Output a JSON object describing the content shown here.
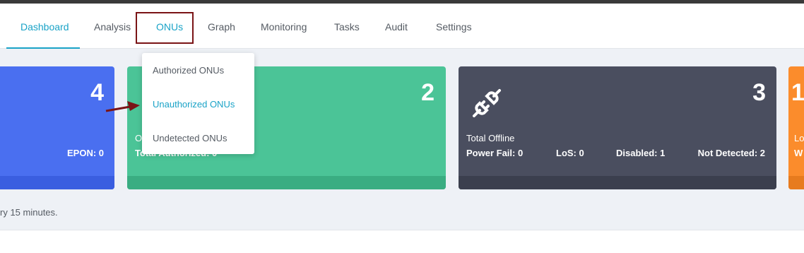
{
  "nav": {
    "items": [
      "Dashboard",
      "Analysis",
      "ONUs",
      "Graph",
      "Monitoring",
      "Tasks",
      "Audit",
      "Settings"
    ],
    "active": "Dashboard",
    "highlighted": "ONUs"
  },
  "onus_dropdown": {
    "items": [
      "Authorized ONUs",
      "Unauthorized ONUs",
      "Undetected ONUs"
    ],
    "active": "Unauthorized ONUs"
  },
  "cards": {
    "blue": {
      "count": "4",
      "stat": "EPON: 0"
    },
    "green": {
      "count": "2",
      "label_fragment": "O",
      "stat_fragment": "Total Authorized: 0"
    },
    "dark": {
      "count": "3",
      "icon": "plug-disconnected-icon",
      "label": "Total Offline",
      "stats": [
        "Power Fail: 0",
        "LoS: 0",
        "Disabled: 1",
        "Not Detected: 2"
      ]
    },
    "orange": {
      "count": "1",
      "label_fragment": "Lo",
      "stat_fragment": "W"
    }
  },
  "footer_note": "ry 15 minutes.",
  "colors": {
    "accent": "#1aa3c7",
    "highlight_box": "#7a1416",
    "card_blue": "#4a6ff0",
    "card_green": "#4bc497",
    "card_dark": "#4a4e5f",
    "card_orange": "#fb8c2c"
  }
}
